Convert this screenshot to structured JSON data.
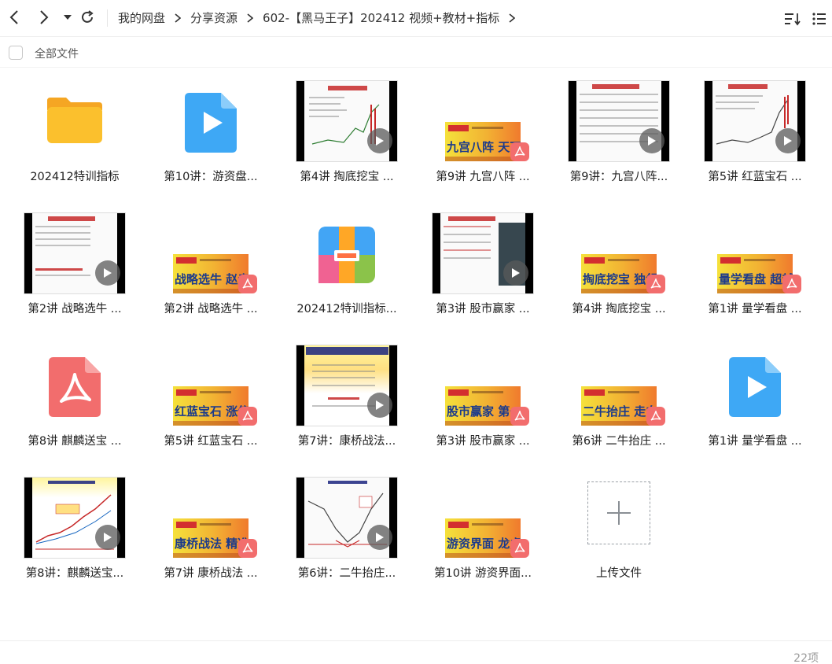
{
  "toolbar": {
    "back_icon": "chevron-left-icon",
    "forward_icon": "chevron-right-icon",
    "history_icon": "caret-down-icon",
    "refresh_icon": "refresh-icon",
    "sort_icon": "sort-icon",
    "view_icon": "list-view-icon"
  },
  "breadcrumb": [
    "我的网盘",
    "分享资源",
    "602-【黑马王子】202412 视频+教材+指标"
  ],
  "select_all_label": "全部文件",
  "items": [
    {
      "name": "202412特训指标",
      "type": "folder"
    },
    {
      "name": "第10讲：游资盘...",
      "type": "video-file"
    },
    {
      "name": "第4讲 掏底挖宝 ...",
      "type": "video-thumb"
    },
    {
      "name": "第9讲 九宫八阵 ...",
      "type": "pdf",
      "banner": "九宫八阵 天下归心"
    },
    {
      "name": "第9讲：九宫八阵...",
      "type": "video-thumb"
    },
    {
      "name": "第5讲 红蓝宝石 ...",
      "type": "video-thumb"
    },
    {
      "name": "第2讲 战略选牛 ...",
      "type": "video-thumb"
    },
    {
      "name": "第2讲 战略选牛 ...",
      "type": "pdf",
      "banner": "战略选牛 赵走越牛"
    },
    {
      "name": "202412特训指标...",
      "type": "archive"
    },
    {
      "name": "第3讲 股市赢家 ...",
      "type": "video-thumb"
    },
    {
      "name": "第4讲 掏底挖宝 ...",
      "type": "pdf",
      "banner": "掏底挖宝 独领风骚"
    },
    {
      "name": "第1讲 量学看盘 ...",
      "type": "pdf",
      "banner": "量学看盘 超越排序"
    },
    {
      "name": "第8讲 麒麟送宝 ...",
      "type": "pdf-file"
    },
    {
      "name": "第5讲 红蓝宝石 ...",
      "type": "pdf",
      "banner": "红蓝宝石 涨停先知"
    },
    {
      "name": "第7讲：康桥战法...",
      "type": "video-thumb"
    },
    {
      "name": "第3讲 股市赢家 ...",
      "type": "pdf",
      "banner": "股市赢家 第一王牌"
    },
    {
      "name": "第6讲 二牛抬庄 ...",
      "type": "pdf",
      "banner": "二牛抬庄 走向辉煌"
    },
    {
      "name": "第1讲 量学看盘 ...",
      "type": "video-file"
    },
    {
      "name": "第8讲：麒麟送宝...",
      "type": "video-thumb"
    },
    {
      "name": "第7讲 康桥战法 ...",
      "type": "pdf",
      "banner": "康桥战法 精准量化"
    },
    {
      "name": "第6讲：二牛抬庄...",
      "type": "video-thumb"
    },
    {
      "name": "第10讲 游资界面...",
      "type": "pdf",
      "banner": "游资界面 龙虎自现"
    },
    {
      "name": "上传文件",
      "type": "upload"
    }
  ],
  "footer": {
    "count": "22项"
  },
  "colors": {
    "folder": "#fbc02d",
    "video": "#3ea8f5",
    "pdf": "#f26d6d"
  }
}
